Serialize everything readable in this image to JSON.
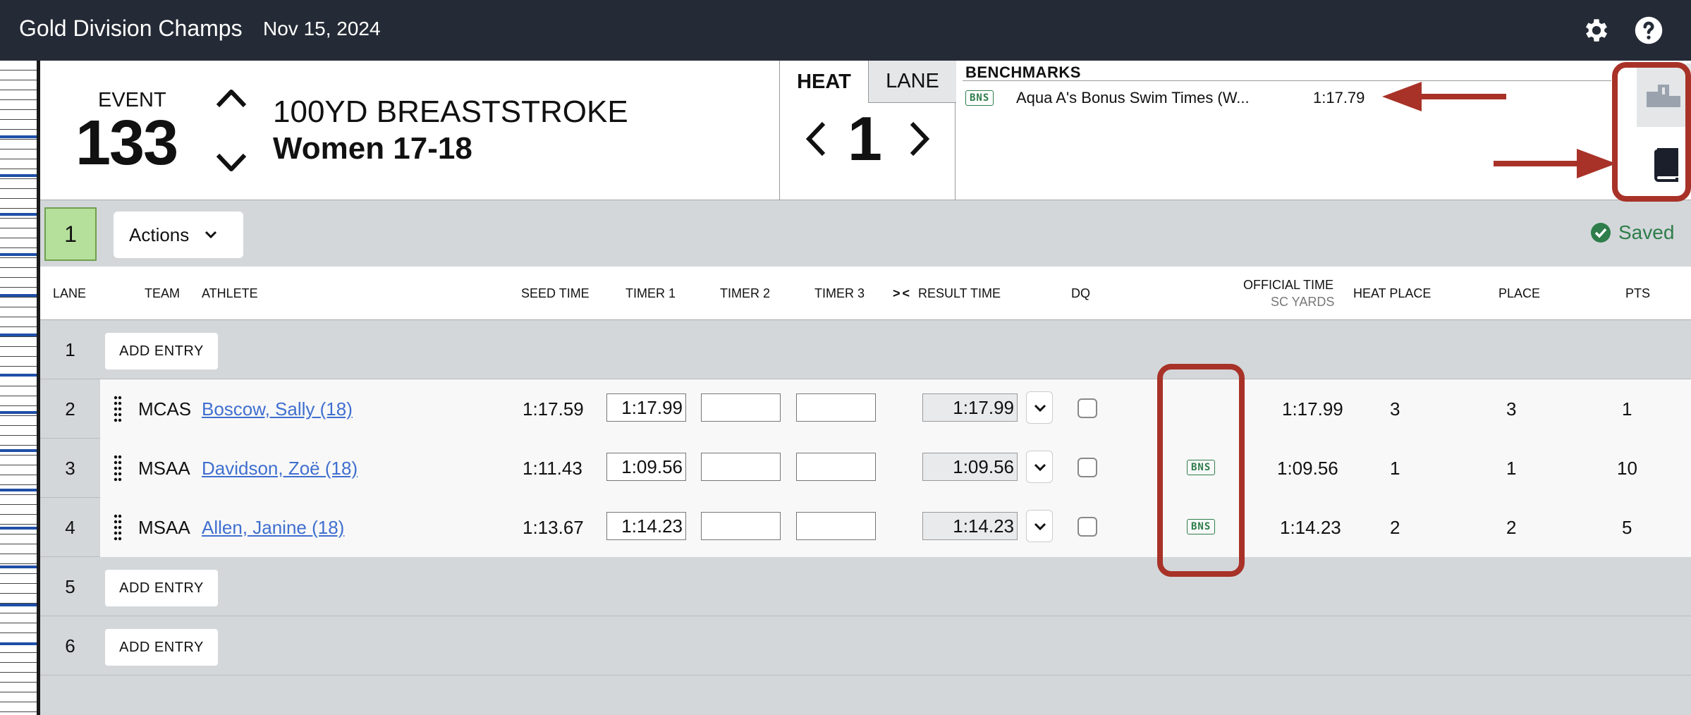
{
  "topbar": {
    "title": "Gold Division Champs",
    "date": "Nov 15, 2024",
    "settings_icon": "gear-icon",
    "help_icon": "help-icon"
  },
  "event": {
    "label": "EVENT",
    "number": "133",
    "name": "100YD BREASTSTROKE",
    "group": "Women 17-18"
  },
  "heat": {
    "tab_heat": "HEAT",
    "tab_lane": "LANE",
    "number": "1"
  },
  "benchmarks": {
    "title": "BENCHMARKS",
    "items": [
      {
        "badge": "BNS",
        "name": "Aqua A's Bonus Swim Times (W...",
        "time": "1:17.79"
      }
    ]
  },
  "actionbar": {
    "heat_badge": "1",
    "actions_label": "Actions",
    "status": "Saved"
  },
  "columns": {
    "lane": "LANE",
    "team": "TEAM",
    "athlete": "ATHLETE",
    "seed": "SEED TIME",
    "timer1": "TIMER 1",
    "timer2": "TIMER 2",
    "timer3": "TIMER 3",
    "swap": "> <",
    "result": "RESULT TIME",
    "dq": "DQ",
    "official": "OFFICIAL TIME",
    "official_sub": "SC YARDS",
    "heat_place": "HEAT PLACE",
    "place": "PLACE",
    "pts": "PTS"
  },
  "rows": [
    {
      "lane": "1",
      "add": "ADD ENTRY"
    },
    {
      "lane": "2",
      "team": "MCAS",
      "athlete": "Boscow, Sally (18)",
      "seed": "1:17.59",
      "timer1": "1:17.99",
      "timer2": "",
      "timer3": "",
      "result": "1:17.99",
      "bns": "",
      "official": "1:17.99",
      "heat_place": "3",
      "place": "3",
      "pts": "1"
    },
    {
      "lane": "3",
      "team": "MSAA",
      "athlete": "Davidson, Zoë (18)",
      "seed": "1:11.43",
      "timer1": "1:09.56",
      "timer2": "",
      "timer3": "",
      "result": "1:09.56",
      "bns": "BNS",
      "official": "1:09.56",
      "heat_place": "1",
      "place": "1",
      "pts": "10"
    },
    {
      "lane": "4",
      "team": "MSAA",
      "athlete": "Allen, Janine (18)",
      "seed": "1:13.67",
      "timer1": "1:14.23",
      "timer2": "",
      "timer3": "",
      "result": "1:14.23",
      "bns": "BNS",
      "official": "1:14.23",
      "heat_place": "2",
      "place": "2",
      "pts": "5"
    },
    {
      "lane": "5",
      "add": "ADD ENTRY"
    },
    {
      "lane": "6",
      "add": "ADD ENTRY"
    }
  ],
  "colors": {
    "topbar": "#252b36",
    "accent_green": "#2e7d4a",
    "link": "#3f6fcf",
    "annotation_red": "#a83228",
    "heat_badge": "#b5e09b"
  }
}
